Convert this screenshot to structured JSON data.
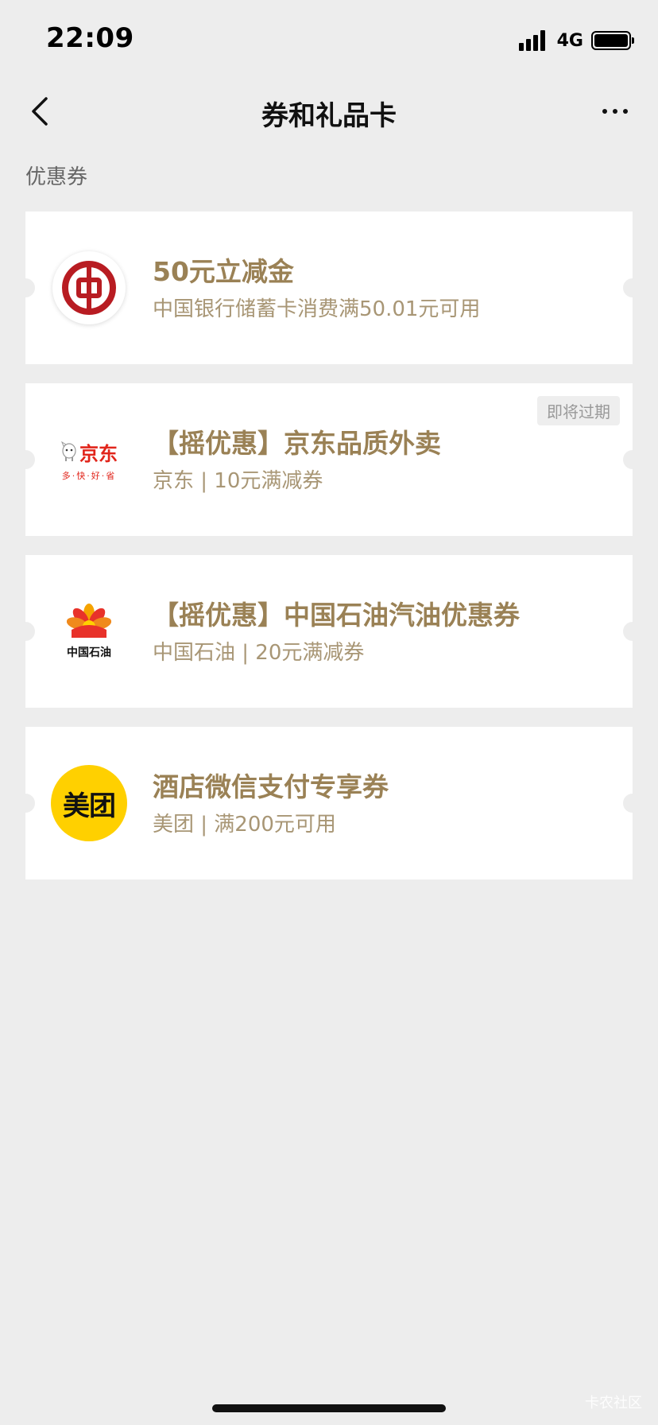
{
  "status_bar": {
    "time": "22:09",
    "network": "4G"
  },
  "nav": {
    "title": "券和礼品卡"
  },
  "section": {
    "label": "优惠券"
  },
  "coupons": [
    {
      "logo": "bank-of-china-logo",
      "title": "50元立减金",
      "subtitle": "中国银行储蓄卡消费满50.01元可用",
      "badge": ""
    },
    {
      "logo": "jd-logo",
      "logo_text": "京东",
      "logo_slogan": "多·快·好·省",
      "title": "【摇优惠】京东品质外卖",
      "subtitle": "京东 | 10元满减券",
      "badge": "即将过期"
    },
    {
      "logo": "petrochina-logo",
      "logo_text": "中国石油",
      "title": "【摇优惠】中国石油汽油优惠券",
      "subtitle": "中国石油 | 20元满减券",
      "badge": ""
    },
    {
      "logo": "meituan-logo",
      "logo_text": "美团",
      "title": "酒店微信支付专享券",
      "subtitle": "美团 | 满200元可用",
      "badge": ""
    }
  ],
  "watermark": "卡农社区",
  "colors": {
    "background": "#ededed",
    "coupon_title": "#9a8155",
    "coupon_subtitle": "#a89675",
    "boc_red": "#b81c22",
    "jd_red": "#e1251b",
    "meituan_yellow": "#ffd000"
  }
}
